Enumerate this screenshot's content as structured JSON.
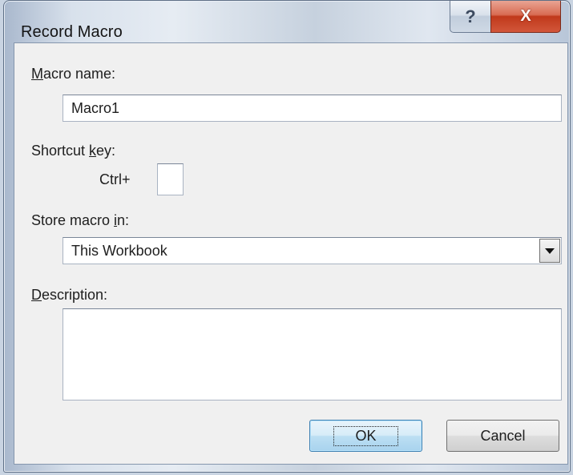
{
  "window": {
    "title": "Record Macro",
    "help_glyph": "?",
    "close_glyph": "X"
  },
  "macro_name": {
    "label_prefix": "",
    "label_access": "M",
    "label_rest": "acro name:",
    "value": "Macro1"
  },
  "shortcut_key": {
    "label_prefix": "Shortcut ",
    "label_access": "k",
    "label_rest": "ey:",
    "ctrl_label": "Ctrl+",
    "value": ""
  },
  "store_macro_in": {
    "label_prefix": "Store macro ",
    "label_access": "i",
    "label_rest": "n:",
    "selected": "This Workbook"
  },
  "description": {
    "label_prefix": "",
    "label_access": "D",
    "label_rest": "escription:",
    "value": ""
  },
  "buttons": {
    "ok": "OK",
    "cancel": "Cancel"
  },
  "icons": {
    "help": "help-icon",
    "close": "close-icon",
    "dropdown": "chevron-down-icon"
  }
}
